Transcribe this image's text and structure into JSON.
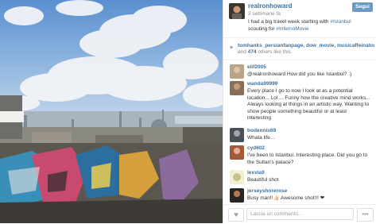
{
  "post": {
    "username": "realronhoward",
    "follow_label": "Segui",
    "time_ago": "3 settimane fa",
    "caption_text": "I had a big travel week starting with",
    "caption_tag1": "#Istanbul",
    "caption_mid": "scouting for",
    "caption_tag2": "#InfernoMovie"
  },
  "likes": {
    "users": "tomhanks_persianfanpage, dow_movie, musicaffeinator",
    "and": "and",
    "count": "474",
    "others_label": "others like this."
  },
  "comments": [
    {
      "user": "elif2005",
      "text": "@realronhoward How did you like Istanbul? :)"
    },
    {
      "user": "wanda99999",
      "text": "Every place I go to now I look at as a potential location... Lol ... Funny how the creative mind works... Always looking at things in an artistic way. Wanting to show people something beautiful or at least interesting"
    },
    {
      "user": "bodennis69",
      "text": "Whata life..."
    },
    {
      "user": "cyd602",
      "text": "I've been to Istanbul. Interesting place. Did you go to the Sultan's palace?"
    },
    {
      "user": "lexvia9",
      "text": "Beautiful shot"
    },
    {
      "user": "jerseyshorerose",
      "text": "Busy man!!👍🏻 Awesome shot!!! ❤"
    }
  ],
  "footer": {
    "comment_placeholder": "Lascia un commento...",
    "more_label": "•••"
  },
  "icons": {
    "heart": "heart-icon",
    "like": "heart-outline-icon"
  }
}
